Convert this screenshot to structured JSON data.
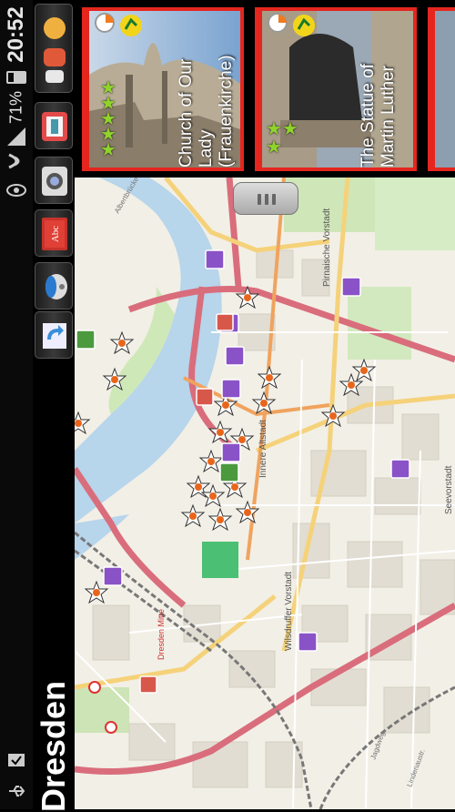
{
  "status": {
    "time": "20:52",
    "battery": "71",
    "battery_unit": "%"
  },
  "app": {
    "title": "Dresden"
  },
  "toolbar": {
    "icons": [
      "weather-icon",
      "calendar-icon",
      "camera-icon",
      "dictionary-icon",
      "satellite-icon",
      "refresh-icon"
    ]
  },
  "cards": [
    {
      "title_line1": "Church of Our",
      "title_line2": "Lady",
      "title_line3": "(Frauenkirche)",
      "stars_full": 5
    },
    {
      "title_line1": "The Statue of",
      "title_line2": "Martin Luther",
      "stars_full": 2
    }
  ],
  "map": {
    "labels": {
      "innere": "Innere Altstadt",
      "pirnaische": "Pirnaische Vorstadt",
      "seevor": "Seevorstadt",
      "wilsdruffer": "Wilsdruffer Vorstadt",
      "mitte": "Dresden Mitte",
      "albert": "Albertbrücke",
      "lindenau": "Lindenaustr.",
      "jagdweg": "Jagdweg"
    }
  }
}
